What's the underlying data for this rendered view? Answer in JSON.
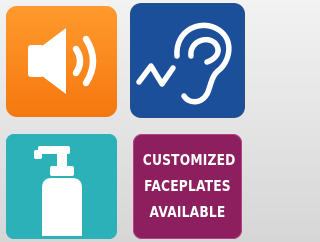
{
  "tiles": [
    {
      "id": "sound",
      "icon": "speaker-volume-icon",
      "color": "#ff8a1e"
    },
    {
      "id": "hearing",
      "icon": "ear-hearing-icon",
      "color": "#1c4f9a"
    },
    {
      "id": "soap",
      "icon": "soap-dispenser-icon",
      "color": "#2cb1b8"
    },
    {
      "id": "customized",
      "icon": null,
      "color": "#8d1f5f"
    }
  ],
  "custom_tile": {
    "line1": "CUSTOMIZED",
    "line2": "FACEPLATES",
    "line3": "AVAILABLE"
  }
}
